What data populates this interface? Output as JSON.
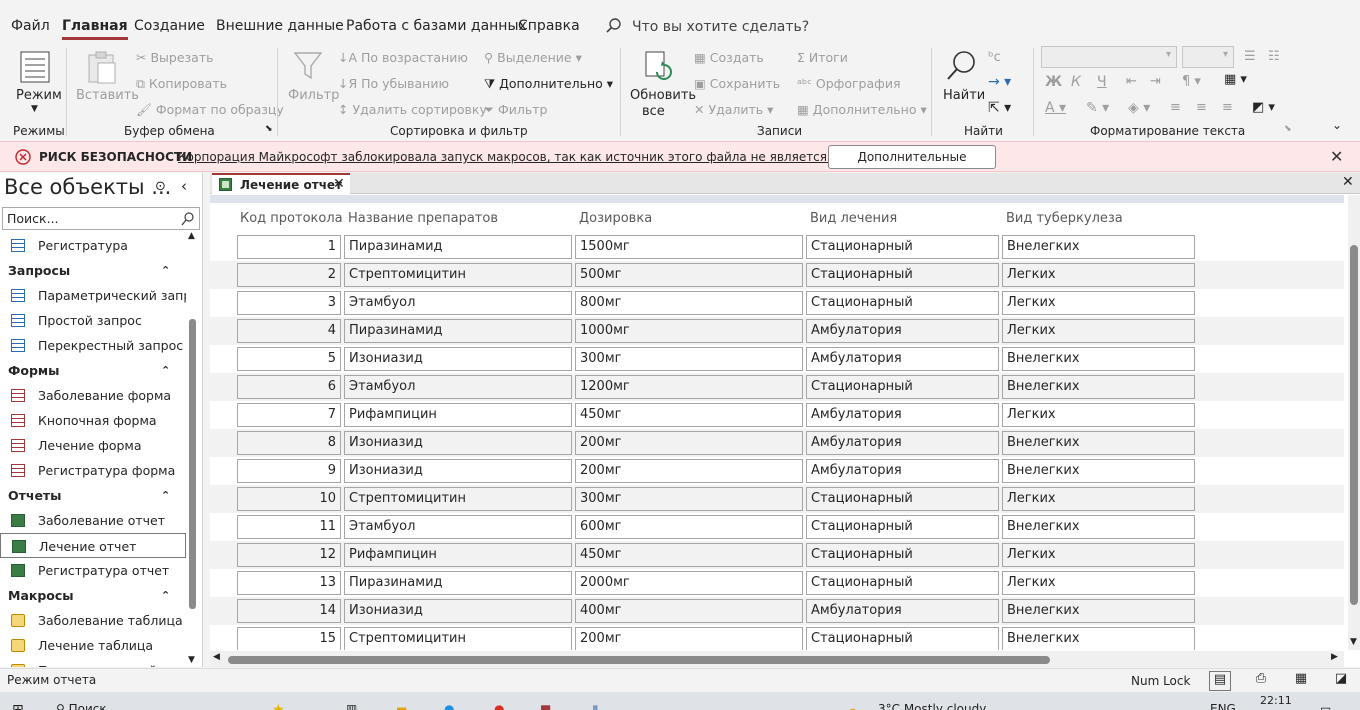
{
  "menu": {
    "items": [
      "Файл",
      "Главная",
      "Создание",
      "Внешние данные",
      "Работа с базами данных",
      "Справка"
    ],
    "active": "Главная",
    "tell_me": "Что вы хотите сделать?"
  },
  "ribbon": {
    "views": {
      "mode": "Режим",
      "group": "Режимы"
    },
    "clipboard": {
      "paste": "Вставить",
      "cut": "Вырезать",
      "copy": "Копировать",
      "format_painter": "Формат по образцу",
      "group": "Буфер обмена"
    },
    "sort_filter": {
      "filter": "Фильтр",
      "ascending": "По возрастанию",
      "descending": "По убыванию",
      "remove_sort": "Удалить сортировку",
      "selection": "Выделение",
      "advanced": "Дополнительно",
      "toggle_filter": "Фильтр",
      "group": "Сортировка и фильтр"
    },
    "records": {
      "refresh": "Обновить",
      "refresh_all": "все",
      "new": "Создать",
      "save": "Сохранить",
      "delete": "Удалить",
      "totals": "Итоги",
      "spelling": "Орфография",
      "more": "Дополнительно",
      "group": "Записи"
    },
    "find": {
      "find": "Найти",
      "group": "Найти"
    },
    "text_format": {
      "bold": "Ж",
      "italic": "К",
      "underline": "Ч",
      "group": "Форматирование текста"
    }
  },
  "security": {
    "title": "РИСК БЕЗОПАСНОСТИ",
    "message": "Корпорация Майкрософт заблокировала запуск макросов, так как источник этого файла не является доверенным.",
    "button": "Дополнительные сведения"
  },
  "nav_pane": {
    "title": "Все объекты ...",
    "search_placeholder": "Поиск...",
    "rows": [
      {
        "kind": "table",
        "label": "Регистратура"
      },
      {
        "kind": "category",
        "label": "Запросы"
      },
      {
        "kind": "query",
        "label": "Параметрический запр..."
      },
      {
        "kind": "query",
        "label": "Простой запрос"
      },
      {
        "kind": "crosstab",
        "label": "Перекрестный запрос"
      },
      {
        "kind": "category",
        "label": "Формы"
      },
      {
        "kind": "form",
        "label": "Заболевание форма"
      },
      {
        "kind": "form",
        "label": "Кнопочная форма"
      },
      {
        "kind": "form",
        "label": "Лечение форма"
      },
      {
        "kind": "form",
        "label": "Регистратура форма"
      },
      {
        "kind": "category",
        "label": "Отчеты"
      },
      {
        "kind": "report",
        "label": "Заболевание отчет"
      },
      {
        "kind": "report",
        "label": "Лечение отчет",
        "selected": true
      },
      {
        "kind": "report",
        "label": "Регистратура отчет"
      },
      {
        "kind": "category",
        "label": "Макросы"
      },
      {
        "kind": "macro",
        "label": "Заболевание таблица"
      },
      {
        "kind": "macro",
        "label": "Лечение таблица"
      },
      {
        "kind": "macro",
        "label": "Параметрический запр..."
      }
    ]
  },
  "document": {
    "tab_label": "Лечение отчет",
    "columns": [
      "Код протокола",
      "Название препаратов",
      "Дозировка",
      "Вид лечения",
      "Вид туберкулеза"
    ],
    "rows": [
      [
        "1",
        "Пиразинамид",
        "1500мг",
        "Стационарный",
        "Внелегких"
      ],
      [
        "2",
        "Стрептомицитин",
        "500мг",
        "Стационарный",
        "Легких"
      ],
      [
        "3",
        "Этамбуол",
        "800мг",
        "Стационарный",
        "Легких"
      ],
      [
        "4",
        "Пиразинамид",
        "1000мг",
        "Амбулатория",
        "Легких"
      ],
      [
        "5",
        "Изониазид",
        "300мг",
        "Амбулатория",
        "Внелегких"
      ],
      [
        "6",
        "Этамбуол",
        "1200мг",
        "Стационарный",
        "Внелегких"
      ],
      [
        "7",
        "Рифампицин",
        "450мг",
        "Амбулатория",
        "Легких"
      ],
      [
        "8",
        "Изониазид",
        "200мг",
        "Амбулатория",
        "Внелегких"
      ],
      [
        "9",
        "Изониазид",
        "200мг",
        "Амбулатория",
        "Внелегких"
      ],
      [
        "10",
        "Стрептомицитин",
        "300мг",
        "Стационарный",
        "Легких"
      ],
      [
        "11",
        "Этамбуол",
        "600мг",
        "Стационарный",
        "Внелегких"
      ],
      [
        "12",
        "Рифампицин",
        "450мг",
        "Стационарный",
        "Легких"
      ],
      [
        "13",
        "Пиразинамид",
        "2000мг",
        "Стационарный",
        "Легких"
      ],
      [
        "14",
        "Изониазид",
        "400мг",
        "Амбулатория",
        "Внелегких"
      ],
      [
        "15",
        "Стрептомицитин",
        "200мг",
        "Стационарный",
        "Внелегких"
      ]
    ]
  },
  "status": {
    "mode": "Режим отчета",
    "num_lock": "Num Lock"
  },
  "taskbar": {
    "search": "Поиск",
    "weather": "3°C  Mostly cloudy",
    "lang": "ENG",
    "time": "22:11"
  },
  "colors": {
    "accent": "#a4373a",
    "security_bg": "#fde7e9",
    "report_icon": "#3a7d44"
  }
}
